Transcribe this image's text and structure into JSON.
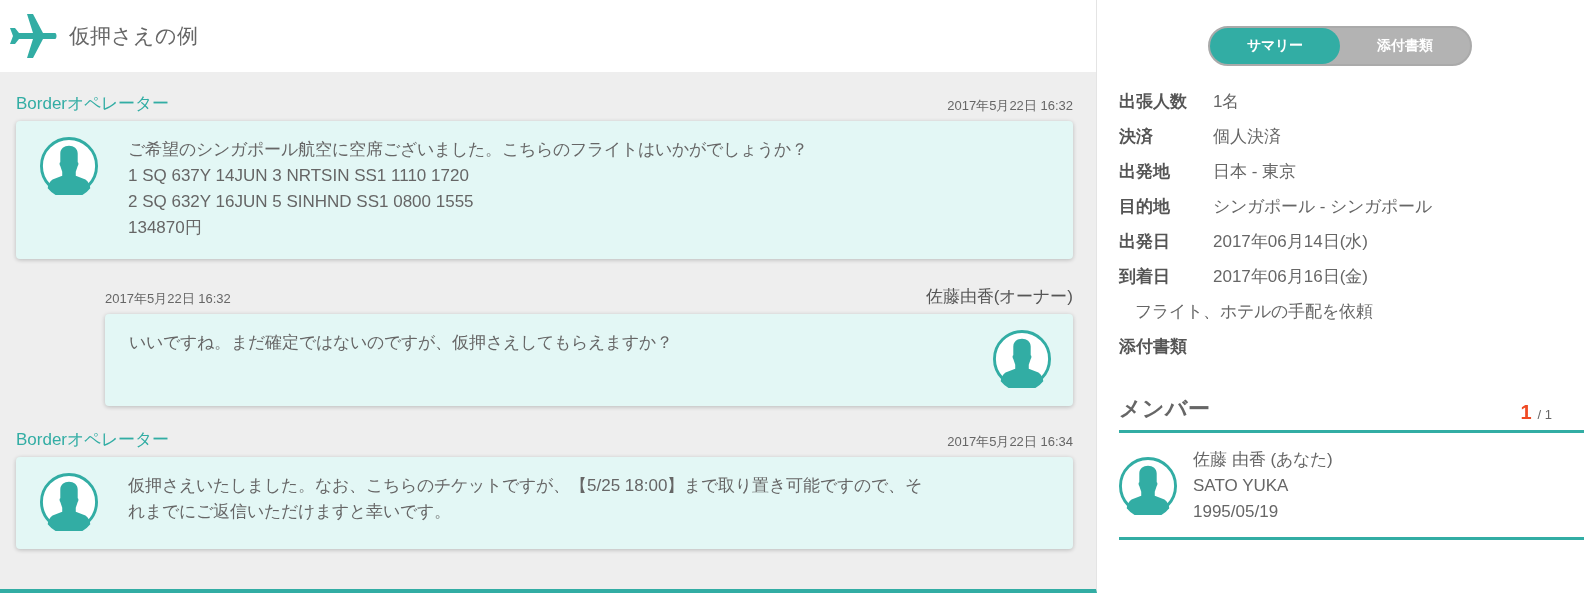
{
  "header": {
    "title": "仮押さえの例"
  },
  "messages": [
    {
      "kind": "operator",
      "sender": "Borderオペレーター",
      "time": "2017年5月22日 16:32",
      "lines": [
        "ご希望のシンガポール航空に空席ございました。こちらのフライトはいかがでしょうか？",
        "1 SQ 637Y 14JUN 3 NRTSIN SS1 1110 1720",
        "2 SQ 632Y 16JUN 5 SINHND SS1 0800 1555",
        "134870円"
      ]
    },
    {
      "kind": "user",
      "sender": "佐藤由香(オーナー)",
      "time": "2017年5月22日 16:32",
      "lines": [
        "いいですね。まだ確定ではないのですが、仮押さえしてもらえますか？"
      ]
    },
    {
      "kind": "operator",
      "sender": "Borderオペレーター",
      "time": "2017年5月22日 16:34",
      "lines": [
        "仮押さえいたしました。なお、こちらのチケットですが、【5/25 18:00】まで取り置き可能ですので、そ",
        "れまでにご返信いただけますと幸いです。"
      ]
    }
  ],
  "tabs": [
    {
      "label": "サマリー",
      "selected": true
    },
    {
      "label": "添付書類",
      "selected": false
    }
  ],
  "summary": [
    {
      "label": "出張人数",
      "value": "1名"
    },
    {
      "label": "決済",
      "value": "個人決済"
    },
    {
      "label": "出発地",
      "value": "日本 - 東京"
    },
    {
      "label": "目的地",
      "value": "シンガポール - シンガポール"
    },
    {
      "label": "出発日",
      "value": "2017年06月14日(水)"
    },
    {
      "label": "到着日",
      "value": "2017年06月16日(金)"
    }
  ],
  "request_note": "フライト、ホテルの手配を依頼",
  "attachments_label": "添付書類",
  "members": {
    "title": "メンバー",
    "count": "1",
    "total": "/ 1",
    "items": [
      {
        "name": "佐藤 由香 (あなた)",
        "romaji": "SATO YUKA",
        "birthdate": "1995/05/19"
      }
    ]
  }
}
